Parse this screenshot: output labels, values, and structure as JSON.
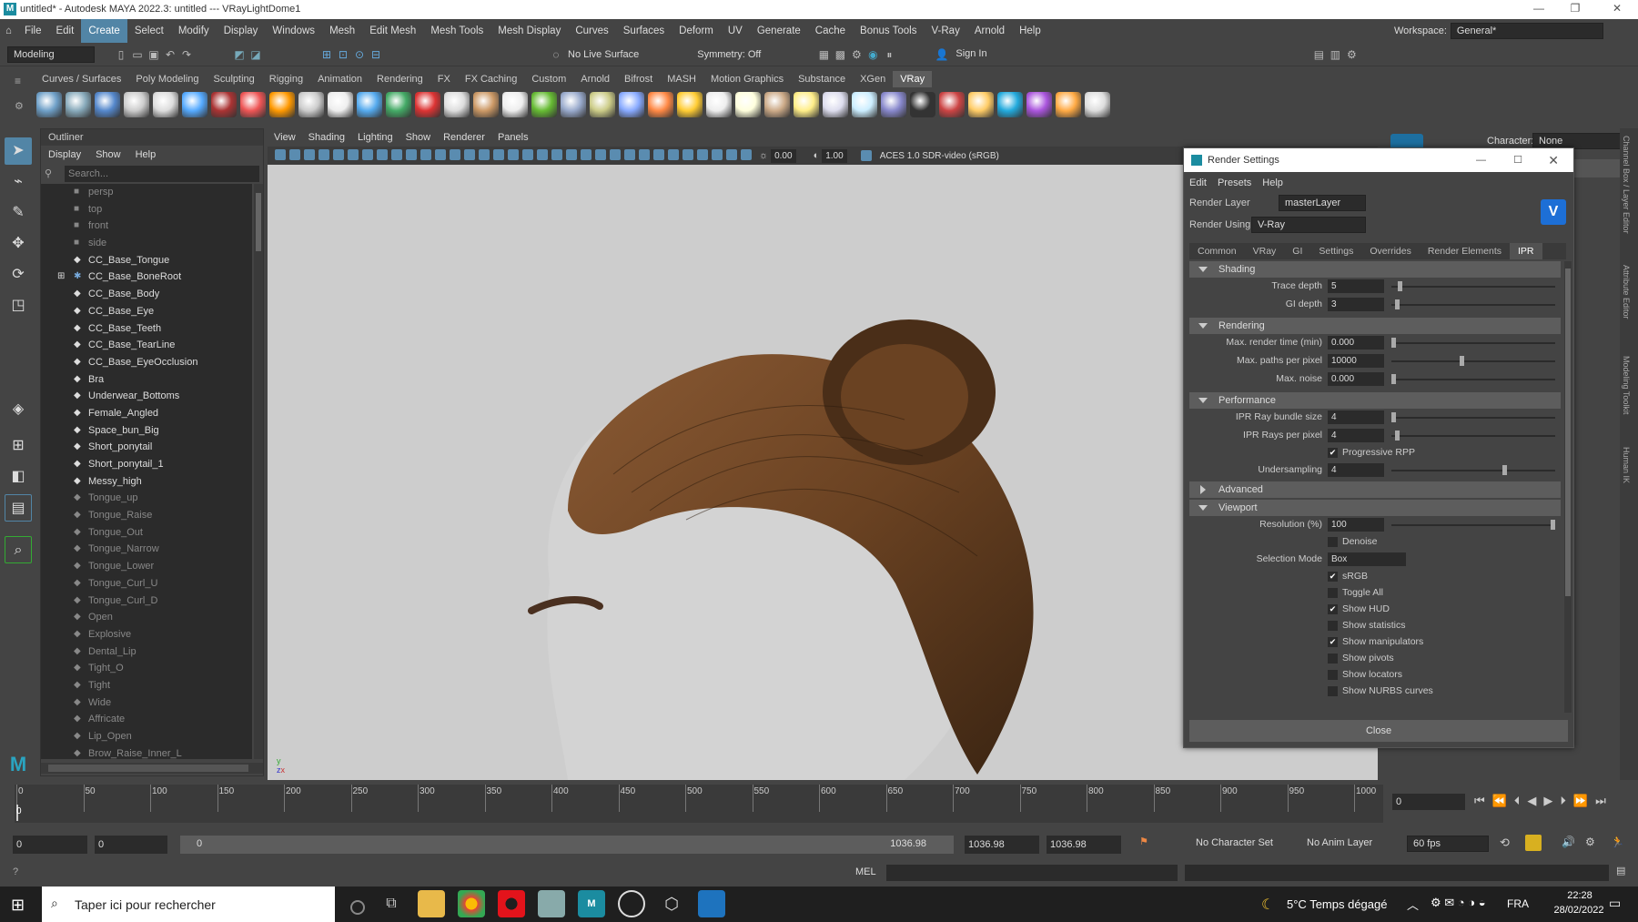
{
  "window": {
    "title": "untitled* - Autodesk MAYA 2022.3: untitled   ---   VRayLightDome1"
  },
  "menus": [
    "File",
    "Edit",
    "Create",
    "Select",
    "Modify",
    "Display",
    "Windows",
    "Mesh",
    "Edit Mesh",
    "Mesh Tools",
    "Mesh Display",
    "Curves",
    "Surfaces",
    "Deform",
    "UV",
    "Generate",
    "Cache",
    "Bonus Tools",
    "V-Ray",
    "Arnold",
    "Help"
  ],
  "workspace": {
    "label": "Workspace:",
    "value": "General*"
  },
  "statusline": {
    "mode": "Modeling",
    "live": "No Live Surface",
    "symmetry": "Symmetry: Off",
    "signin": "Sign In"
  },
  "shelf_tabs": [
    "Curves / Surfaces",
    "Poly Modeling",
    "Sculpting",
    "Rigging",
    "Animation",
    "Rendering",
    "FX",
    "FX Caching",
    "Custom",
    "Arnold",
    "Bifrost",
    "MASH",
    "Motion Graphics",
    "Substance",
    "XGen",
    "VRay"
  ],
  "outliner": {
    "title": "Outliner",
    "menu": [
      "Display",
      "Show",
      "Help"
    ],
    "search_placeholder": "Search...",
    "items": [
      {
        "name": "persp",
        "type": "cam"
      },
      {
        "name": "top",
        "type": "cam"
      },
      {
        "name": "front",
        "type": "cam"
      },
      {
        "name": "side",
        "type": "cam"
      },
      {
        "name": "CC_Base_Tongue",
        "type": "norm"
      },
      {
        "name": "CC_Base_BoneRoot",
        "type": "norm"
      },
      {
        "name": "CC_Base_Body",
        "type": "norm"
      },
      {
        "name": "CC_Base_Eye",
        "type": "norm"
      },
      {
        "name": "CC_Base_Teeth",
        "type": "norm"
      },
      {
        "name": "CC_Base_TearLine",
        "type": "norm"
      },
      {
        "name": "CC_Base_EyeOcclusion",
        "type": "norm"
      },
      {
        "name": "Bra",
        "type": "norm"
      },
      {
        "name": "Underwear_Bottoms",
        "type": "norm"
      },
      {
        "name": "Female_Angled",
        "type": "norm"
      },
      {
        "name": "Space_bun_Big",
        "type": "norm"
      },
      {
        "name": "Short_ponytail",
        "type": "norm"
      },
      {
        "name": "Short_ponytail_1",
        "type": "norm"
      },
      {
        "name": "Messy_high",
        "type": "norm"
      },
      {
        "name": "Tongue_up",
        "type": "dim"
      },
      {
        "name": "Tongue_Raise",
        "type": "dim"
      },
      {
        "name": "Tongue_Out",
        "type": "dim"
      },
      {
        "name": "Tongue_Narrow",
        "type": "dim"
      },
      {
        "name": "Tongue_Lower",
        "type": "dim"
      },
      {
        "name": "Tongue_Curl_U",
        "type": "dim"
      },
      {
        "name": "Tongue_Curl_D",
        "type": "dim"
      },
      {
        "name": "Open",
        "type": "dim"
      },
      {
        "name": "Explosive",
        "type": "dim"
      },
      {
        "name": "Dental_Lip",
        "type": "dim"
      },
      {
        "name": "Tight_O",
        "type": "dim"
      },
      {
        "name": "Tight",
        "type": "dim"
      },
      {
        "name": "Wide",
        "type": "dim"
      },
      {
        "name": "Affricate",
        "type": "dim"
      },
      {
        "name": "Lip_Open",
        "type": "dim"
      },
      {
        "name": "Brow_Raise_Inner_L",
        "type": "dim"
      }
    ]
  },
  "viewport": {
    "menu": [
      "View",
      "Shading",
      "Lighting",
      "Show",
      "Renderer",
      "Panels"
    ],
    "exposure": "0.00",
    "gamma": "1.00",
    "colorspace": "ACES 1.0 SDR-video (sRGB)"
  },
  "channel": {
    "character_label": "Character:",
    "character_value": "None"
  },
  "side_tabs": [
    "Channel Box / Layer Editor",
    "Attribute Editor",
    "Modeling Toolkit",
    "Human IK"
  ],
  "render_settings": {
    "title": "Render Settings",
    "menu": [
      "Edit",
      "Presets",
      "Help"
    ],
    "render_layer_label": "Render Layer",
    "render_layer": "masterLayer",
    "render_using_label": "Render Using",
    "render_using": "V-Ray",
    "tabs": [
      "Common",
      "VRay",
      "GI",
      "Settings",
      "Overrides",
      "Render Elements",
      "IPR"
    ],
    "sections": {
      "shading": "Shading",
      "rendering": "Rendering",
      "performance": "Performance",
      "advanced": "Advanced",
      "viewport": "Viewport"
    },
    "trace_depth": {
      "label": "Trace depth",
      "value": "5",
      "slider": 0.04
    },
    "gi_depth": {
      "label": "GI depth",
      "value": "3",
      "slider": 0.02
    },
    "max_render_time": {
      "label": "Max. render time (min)",
      "value": "0.000",
      "slider": 0
    },
    "max_paths": {
      "label": "Max. paths per pixel",
      "value": "10000",
      "slider": 0.43
    },
    "max_noise": {
      "label": "Max. noise",
      "value": "0.000",
      "slider": 0
    },
    "ray_bundle": {
      "label": "IPR Ray bundle size",
      "value": "4",
      "slider": 0
    },
    "rays_per_pixel": {
      "label": "IPR Rays per pixel",
      "value": "4",
      "slider": 0.02
    },
    "progressive": {
      "label": "Progressive RPP",
      "checked": "✔"
    },
    "undersampling": {
      "label": "Undersampling",
      "value": "4",
      "slider": 0.7
    },
    "resolution": {
      "label": "Resolution (%)",
      "value": "100",
      "slider": 1
    },
    "denoise": {
      "label": "Denoise",
      "checked": ""
    },
    "selection_mode": {
      "label": "Selection Mode",
      "value": "Box"
    },
    "checks": [
      {
        "label": "sRGB",
        "checked": "✔"
      },
      {
        "label": "Toggle All",
        "checked": ""
      },
      {
        "label": "Show HUD",
        "checked": "✔"
      },
      {
        "label": "Show statistics",
        "checked": ""
      },
      {
        "label": "Show manipulators",
        "checked": "✔"
      },
      {
        "label": "Show pivots",
        "checked": ""
      },
      {
        "label": "Show locators",
        "checked": ""
      },
      {
        "label": "Show NURBS curves",
        "checked": ""
      }
    ],
    "close": "Close"
  },
  "timeline": {
    "ticks": [
      "0",
      "50",
      "100",
      "150",
      "200",
      "250",
      "300",
      "350",
      "400",
      "450",
      "500",
      "550",
      "600",
      "650",
      "700",
      "750",
      "800",
      "850",
      "900",
      "950",
      "1000"
    ],
    "current": "0",
    "frame_field": "0"
  },
  "range": {
    "start": "0",
    "start2": "0",
    "slider_start": "0",
    "slider_end": "1036.98",
    "end1": "1036.98",
    "end2": "1036.98",
    "character_set": "No Character Set",
    "anim_layer": "No Anim Layer",
    "fps": "60 fps"
  },
  "cmd": {
    "lang": "MEL"
  },
  "taskbar": {
    "search": "Taper ici pour rechercher",
    "weather": "5°C  Temps dégagé",
    "lang": "FRA",
    "time": "22:28",
    "date": "28/02/2022"
  }
}
